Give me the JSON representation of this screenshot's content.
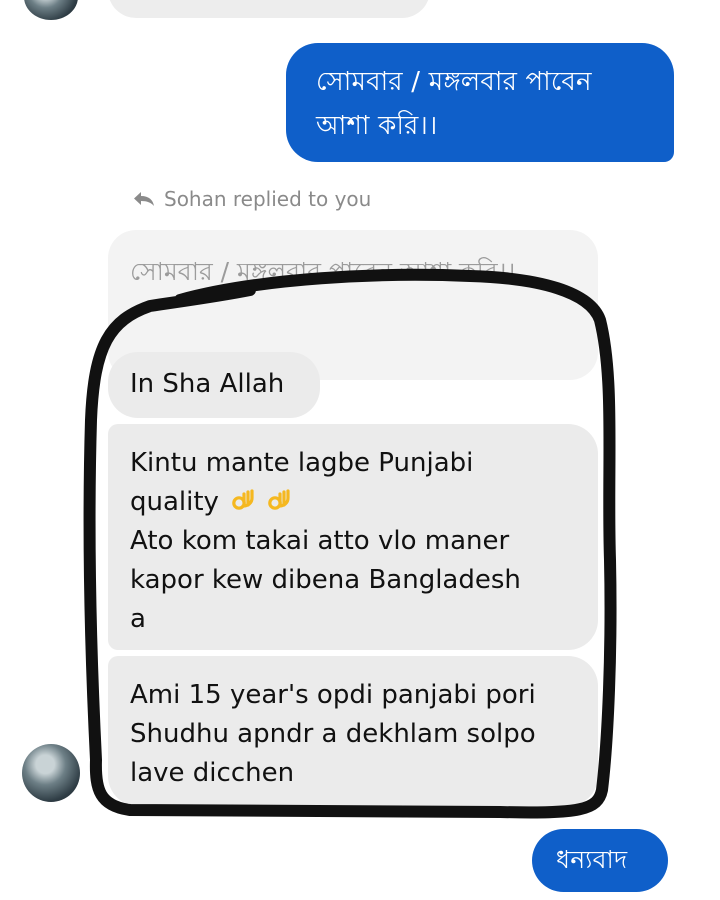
{
  "messages": {
    "outgoing_1": "সোমবার / মঙ্গলবার পাবেন আশা করি।।",
    "reply_note": "Sohan replied to you",
    "quoted_text": "সোমবার / মঙ্গলবার পাবেন আশা করি।।",
    "incoming_1": "In Sha Allah",
    "incoming_2_line_1": "Kintu mante lagbe Punjabi",
    "incoming_2_line_2": "quality",
    "incoming_2_line_3": "Ato kom takai atto vlo maner",
    "incoming_2_line_4": "kapor kew dibena Bangladesh",
    "incoming_2_line_5": "a",
    "incoming_3_line_1": "Ami 15 year's opdi panjabi pori",
    "incoming_3_line_2": "Shudhu apndr a dekhlam solpo",
    "incoming_3_line_3": "lave dicchen",
    "outgoing_2": "ধন্যবাদ"
  },
  "icons": {
    "reply": "reply-arrow-icon",
    "emoji": "ok-hand-emoji-icon"
  },
  "colors": {
    "outgoing_bubble": "#0f5fc9",
    "incoming_bubble": "#ebebeb",
    "quoted_bubble": "#f3f3f3",
    "outline": "#111111"
  }
}
